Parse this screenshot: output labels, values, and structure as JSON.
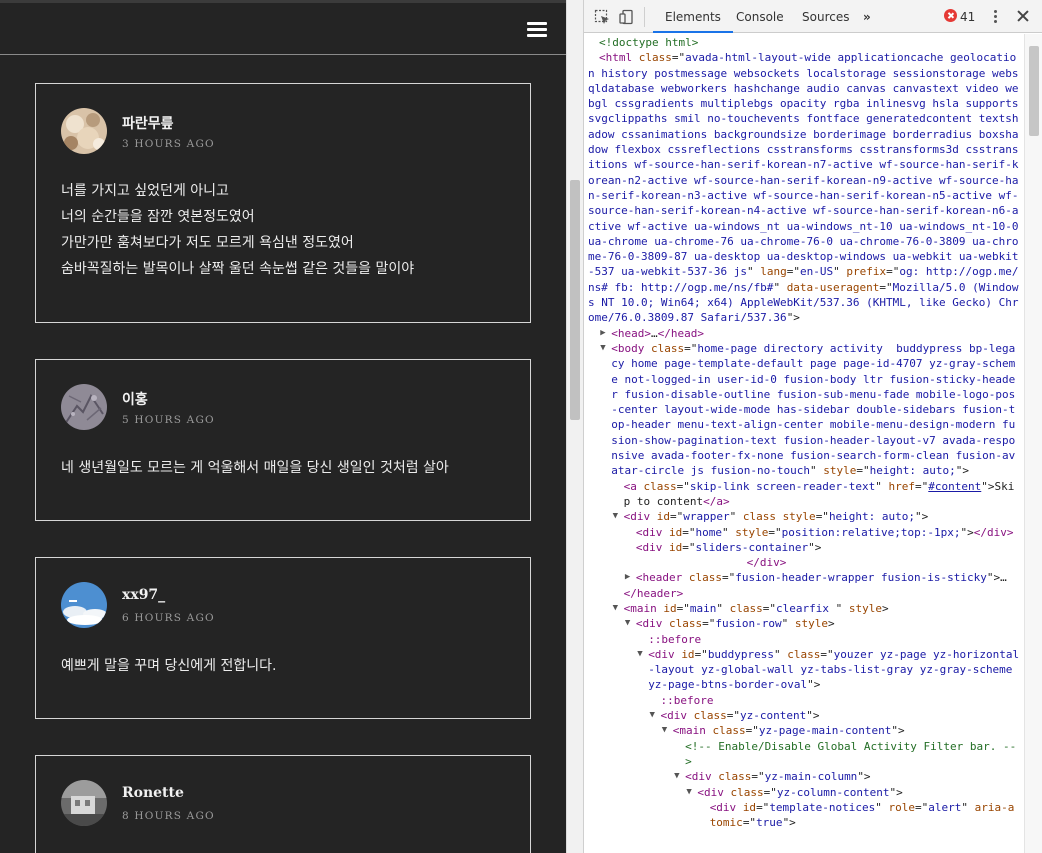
{
  "activity": {
    "posts": [
      {
        "name": "파란무릎",
        "time": "3 HOURS AGO",
        "lines": [
          "너를 가지고 싶었던게 아니고",
          "너의 순간들을 잠깐 엿본정도였어",
          "가만가만 훔쳐보다가 저도 모르게 욕심낸 정도였어",
          "숨바꼭질하는 발목이나 살짝 울던 속눈썹 같은 것들을 말이야"
        ]
      },
      {
        "name": "이홍",
        "time": "5 HOURS AGO",
        "lines": [
          "네 생년월일도 모르는 게 억울해서 매일을 당신 생일인 것처럼 살아"
        ]
      },
      {
        "name": "xx97_",
        "time": "6 HOURS AGO",
        "lines": [
          "예쁘게 말을 꾸며 당신에게 전합니다."
        ]
      },
      {
        "name": "Ronette",
        "time": "8 HOURS AGO",
        "lines": []
      }
    ]
  },
  "devtools": {
    "tabs": {
      "elements": "Elements",
      "console": "Console",
      "sources": "Sources",
      "more": "»"
    },
    "error_count": "41",
    "icons": {
      "inspect": "inspect-element-icon",
      "device": "device-toolbar-icon",
      "error": "error-icon",
      "menu": "kebab-menu-icon",
      "close": "close-icon"
    },
    "accent": "#1a73e8"
  },
  "dom": [
    {
      "indent": 0,
      "arrow": "",
      "parts": [
        {
          "c": "comment",
          "t": "<!doctype html>"
        }
      ]
    },
    {
      "indent": 0,
      "arrow": "",
      "parts": [
        {
          "c": "tag",
          "t": "<html "
        },
        {
          "c": "attr",
          "t": "class"
        },
        {
          "c": "plain",
          "t": "=\""
        },
        {
          "c": "val",
          "t": "avada-html-layout-wide applicationcache geolocation history postmessage websockets localstorage sessionstorage websqldatabase webworkers hashchange audio canvas canvastext video webgl cssgradients multiplebgs opacity rgba inlinesvg hsla supports svgclippaths smil no-touchevents fontface generatedcontent textshadow cssanimations backgroundsize borderimage borderradius boxshadow flexbox cssreflections csstransforms csstransforms3d csstransitions wf-source-han-serif-korean-n7-active wf-source-han-serif-korean-n2-active wf-source-han-serif-korean-n9-active wf-source-han-serif-korean-n3-active wf-source-han-serif-korean-n5-active wf-source-han-serif-korean-n4-active wf-source-han-serif-korean-n6-active wf-active ua-windows_nt ua-windows_nt-10 ua-windows_nt-10-0 ua-chrome ua-chrome-76 ua-chrome-76-0 ua-chrome-76-0-3809 ua-chrome-76-0-3809-87 ua-desktop ua-desktop-windows ua-webkit ua-webkit-537 ua-webkit-537-36 js"
        },
        {
          "c": "plain",
          "t": "\" "
        },
        {
          "c": "attr",
          "t": "lang"
        },
        {
          "c": "plain",
          "t": "=\""
        },
        {
          "c": "val",
          "t": "en-US"
        },
        {
          "c": "plain",
          "t": "\" "
        },
        {
          "c": "attr",
          "t": "prefix"
        },
        {
          "c": "plain",
          "t": "=\""
        },
        {
          "c": "val",
          "t": "og: http://ogp.me/ns# fb: http://ogp.me/ns/fb#"
        },
        {
          "c": "plain",
          "t": "\" "
        },
        {
          "c": "attr",
          "t": "data-useragent"
        },
        {
          "c": "plain",
          "t": "=\""
        },
        {
          "c": "val",
          "t": "Mozilla/5.0 (Windows NT 10.0; Win64; x64) AppleWebKit/537.36 (KHTML, like Gecko) Chrome/76.0.3809.87 Safari/537.36"
        },
        {
          "c": "plain",
          "t": "\">"
        }
      ]
    },
    {
      "indent": 1,
      "arrow": "▶",
      "parts": [
        {
          "c": "tag",
          "t": "<head>"
        },
        {
          "c": "plain",
          "t": "…"
        },
        {
          "c": "tag",
          "t": "</head>"
        }
      ]
    },
    {
      "indent": 1,
      "arrow": "▼",
      "parts": [
        {
          "c": "tag",
          "t": "<body "
        },
        {
          "c": "attr",
          "t": "class"
        },
        {
          "c": "plain",
          "t": "=\""
        },
        {
          "c": "val",
          "t": "home-page directory activity  buddypress bp-legacy home page-template-default page page-id-4707 yz-gray-scheme not-logged-in user-id-0 fusion-body ltr fusion-sticky-header fusion-disable-outline fusion-sub-menu-fade mobile-logo-pos-center layout-wide-mode has-sidebar double-sidebars fusion-top-header menu-text-align-center mobile-menu-design-modern fusion-show-pagination-text fusion-header-layout-v7 avada-responsive avada-footer-fx-none fusion-search-form-clean fusion-avatar-circle js fusion-no-touch"
        },
        {
          "c": "plain",
          "t": "\" "
        },
        {
          "c": "attr",
          "t": "style"
        },
        {
          "c": "plain",
          "t": "=\""
        },
        {
          "c": "val",
          "t": "height: auto;"
        },
        {
          "c": "plain",
          "t": "\">"
        }
      ]
    },
    {
      "indent": 2,
      "arrow": "",
      "parts": [
        {
          "c": "tag",
          "t": "<a "
        },
        {
          "c": "attr",
          "t": "class"
        },
        {
          "c": "plain",
          "t": "=\""
        },
        {
          "c": "val",
          "t": "skip-link screen-reader-text"
        },
        {
          "c": "plain",
          "t": "\" "
        },
        {
          "c": "attr",
          "t": "href"
        },
        {
          "c": "plain",
          "t": "=\""
        },
        {
          "c": "link",
          "t": "#content"
        },
        {
          "c": "plain",
          "t": "\">Skip to content"
        },
        {
          "c": "tag",
          "t": "</a>"
        }
      ]
    },
    {
      "indent": 2,
      "arrow": "▼",
      "parts": [
        {
          "c": "tag",
          "t": "<div "
        },
        {
          "c": "attr",
          "t": "id"
        },
        {
          "c": "plain",
          "t": "=\""
        },
        {
          "c": "val",
          "t": "wrapper"
        },
        {
          "c": "plain",
          "t": "\" "
        },
        {
          "c": "attr",
          "t": "class style"
        },
        {
          "c": "plain",
          "t": "=\""
        },
        {
          "c": "val",
          "t": "height: auto;"
        },
        {
          "c": "plain",
          "t": "\">"
        }
      ]
    },
    {
      "indent": 3,
      "arrow": "",
      "parts": [
        {
          "c": "tag",
          "t": "<div "
        },
        {
          "c": "attr",
          "t": "id"
        },
        {
          "c": "plain",
          "t": "=\""
        },
        {
          "c": "val",
          "t": "home"
        },
        {
          "c": "plain",
          "t": "\" "
        },
        {
          "c": "attr",
          "t": "style"
        },
        {
          "c": "plain",
          "t": "=\""
        },
        {
          "c": "val",
          "t": "position:relative;top:-1px;"
        },
        {
          "c": "plain",
          "t": "\">"
        },
        {
          "c": "tag",
          "t": "</div>"
        }
      ]
    },
    {
      "indent": 3,
      "arrow": "",
      "parts": [
        {
          "c": "tag",
          "t": "<div "
        },
        {
          "c": "attr",
          "t": "id"
        },
        {
          "c": "plain",
          "t": "=\""
        },
        {
          "c": "val",
          "t": "sliders-container"
        },
        {
          "c": "plain",
          "t": "\">"
        }
      ]
    },
    {
      "indent": 12,
      "arrow": "",
      "parts": [
        {
          "c": "tag",
          "t": "</div>"
        }
      ]
    },
    {
      "indent": 3,
      "arrow": "▶",
      "parts": [
        {
          "c": "tag",
          "t": "<header "
        },
        {
          "c": "attr",
          "t": "class"
        },
        {
          "c": "plain",
          "t": "=\""
        },
        {
          "c": "val",
          "t": "fusion-header-wrapper fusion-is-sticky"
        },
        {
          "c": "plain",
          "t": "\">…"
        }
      ]
    },
    {
      "indent": 2,
      "arrow": "",
      "parts": [
        {
          "c": "tag",
          "t": "</header>"
        }
      ]
    },
    {
      "indent": 2,
      "arrow": "▼",
      "parts": [
        {
          "c": "tag",
          "t": "<main "
        },
        {
          "c": "attr",
          "t": "id"
        },
        {
          "c": "plain",
          "t": "=\""
        },
        {
          "c": "val",
          "t": "main"
        },
        {
          "c": "plain",
          "t": "\" "
        },
        {
          "c": "attr",
          "t": "class"
        },
        {
          "c": "plain",
          "t": "=\""
        },
        {
          "c": "val",
          "t": "clearfix "
        },
        {
          "c": "plain",
          "t": "\" "
        },
        {
          "c": "attr",
          "t": "style"
        },
        {
          "c": "plain",
          "t": ">"
        }
      ]
    },
    {
      "indent": 3,
      "arrow": "▼",
      "parts": [
        {
          "c": "tag",
          "t": "<div "
        },
        {
          "c": "attr",
          "t": "class"
        },
        {
          "c": "plain",
          "t": "=\""
        },
        {
          "c": "val",
          "t": "fusion-row"
        },
        {
          "c": "plain",
          "t": "\" "
        },
        {
          "c": "attr",
          "t": "style"
        },
        {
          "c": "plain",
          "t": ">"
        }
      ]
    },
    {
      "indent": 4,
      "arrow": "",
      "parts": [
        {
          "c": "pseudo",
          "t": "::before"
        }
      ]
    },
    {
      "indent": 4,
      "arrow": "▼",
      "parts": [
        {
          "c": "tag",
          "t": "<div "
        },
        {
          "c": "attr",
          "t": "id"
        },
        {
          "c": "plain",
          "t": "=\""
        },
        {
          "c": "val",
          "t": "buddypress"
        },
        {
          "c": "plain",
          "t": "\" "
        },
        {
          "c": "attr",
          "t": "class"
        },
        {
          "c": "plain",
          "t": "=\""
        },
        {
          "c": "val",
          "t": "youzer yz-page yz-horizontal-layout yz-global-wall yz-tabs-list-gray yz-gray-scheme yz-page-btns-border-oval"
        },
        {
          "c": "plain",
          "t": "\">"
        }
      ]
    },
    {
      "indent": 5,
      "arrow": "",
      "parts": [
        {
          "c": "pseudo",
          "t": "::before"
        }
      ]
    },
    {
      "indent": 5,
      "arrow": "▼",
      "parts": [
        {
          "c": "tag",
          "t": "<div "
        },
        {
          "c": "attr",
          "t": "class"
        },
        {
          "c": "plain",
          "t": "=\""
        },
        {
          "c": "val",
          "t": "yz-content"
        },
        {
          "c": "plain",
          "t": "\">"
        }
      ]
    },
    {
      "indent": 6,
      "arrow": "▼",
      "parts": [
        {
          "c": "tag",
          "t": "<main "
        },
        {
          "c": "attr",
          "t": "class"
        },
        {
          "c": "plain",
          "t": "=\""
        },
        {
          "c": "val",
          "t": "yz-page-main-content"
        },
        {
          "c": "plain",
          "t": "\">"
        }
      ]
    },
    {
      "indent": 7,
      "arrow": "",
      "parts": [
        {
          "c": "comment",
          "t": "<!-- Enable/Disable Global Activity Filter bar. -->"
        }
      ]
    },
    {
      "indent": 7,
      "arrow": "▼",
      "parts": [
        {
          "c": "tag",
          "t": "<div "
        },
        {
          "c": "attr",
          "t": "class"
        },
        {
          "c": "plain",
          "t": "=\""
        },
        {
          "c": "val",
          "t": "yz-main-column"
        },
        {
          "c": "plain",
          "t": "\">"
        }
      ]
    },
    {
      "indent": 8,
      "arrow": "▼",
      "parts": [
        {
          "c": "tag",
          "t": "<div "
        },
        {
          "c": "attr",
          "t": "class"
        },
        {
          "c": "plain",
          "t": "=\""
        },
        {
          "c": "val",
          "t": "yz-column-content"
        },
        {
          "c": "plain",
          "t": "\">"
        }
      ]
    },
    {
      "indent": 9,
      "arrow": "",
      "parts": [
        {
          "c": "tag",
          "t": "<div "
        },
        {
          "c": "attr",
          "t": "id"
        },
        {
          "c": "plain",
          "t": "=\""
        },
        {
          "c": "val",
          "t": "template-notices"
        },
        {
          "c": "plain",
          "t": "\" "
        },
        {
          "c": "attr",
          "t": "role"
        },
        {
          "c": "plain",
          "t": "=\""
        },
        {
          "c": "val",
          "t": "alert"
        },
        {
          "c": "plain",
          "t": "\" "
        },
        {
          "c": "attr",
          "t": "aria-atomic"
        },
        {
          "c": "plain",
          "t": "=\""
        },
        {
          "c": "val",
          "t": "true"
        },
        {
          "c": "plain",
          "t": "\">"
        }
      ]
    }
  ]
}
